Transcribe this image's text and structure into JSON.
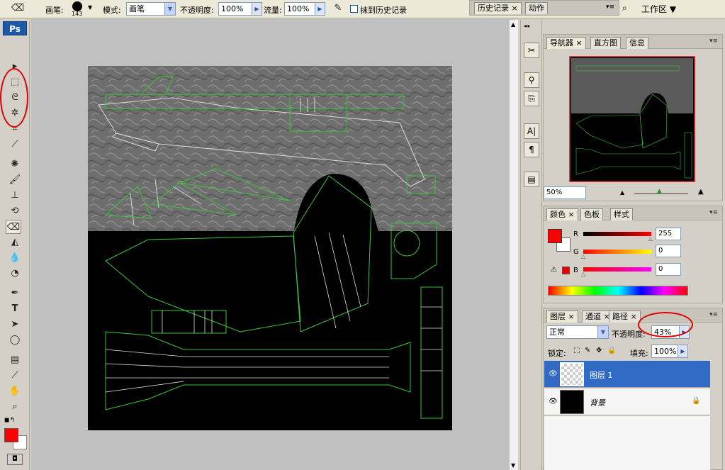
{
  "options_bar": {
    "brush_label": "画笔:",
    "brush_size": "143",
    "mode_label": "模式:",
    "mode_value": "画笔",
    "opacity_label": "不透明度:",
    "opacity_value": "100%",
    "flow_label": "流量:",
    "flow_value": "100%",
    "erase_history_label": "抹到历史记录",
    "history_tab": "历史记录",
    "actions_tab": "动作",
    "workspace_label": "工作区"
  },
  "toolbox": {
    "logo": "Ps"
  },
  "navigator": {
    "tabs": [
      "导航器",
      "直方图",
      "信息"
    ],
    "zoom": "50%"
  },
  "color_panel": {
    "tabs": [
      "颜色",
      "色板",
      "样式"
    ],
    "r_label": "R",
    "r_value": "255",
    "g_label": "G",
    "g_value": "0",
    "b_label": "B",
    "b_value": "0"
  },
  "layers_panel": {
    "tabs": [
      "图层",
      "通道",
      "路径"
    ],
    "blend_mode": "正常",
    "opacity_label": "不透明度:",
    "opacity_value": "43%",
    "lock_label": "锁定:",
    "fill_label": "填充:",
    "fill_value": "100%",
    "layers": [
      {
        "name": "图层 1",
        "selected": true
      },
      {
        "name": "背景",
        "selected": false
      }
    ]
  },
  "colors": {
    "accent_selection": "#316ac5",
    "foreground": "#ff0000",
    "annotation": "#e00000"
  }
}
